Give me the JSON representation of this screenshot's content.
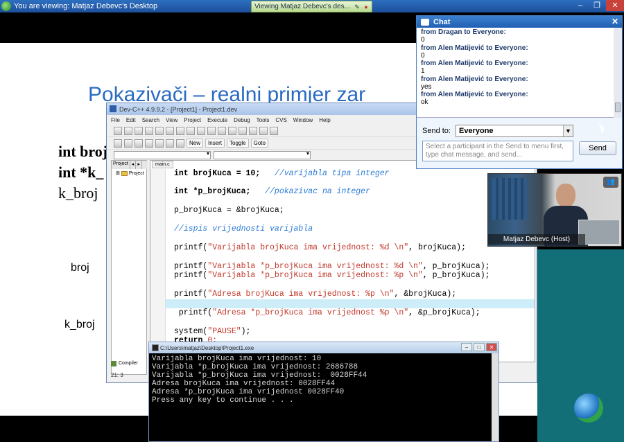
{
  "viewer_bar": {
    "title": "You are viewing: Matjaz Debevc's Desktop",
    "tab_label": "Viewing Matjaz Debevc's des..."
  },
  "slide": {
    "title": "Pokazivači – realni primjer zar",
    "line1": "int broj",
    "line2": "int *k_",
    "line3": "k_broj",
    "label_broj": "broj",
    "label_kbroj": "k_broj"
  },
  "devcpp": {
    "title": "Dev-C++ 4.9.9.2 - [Project1] - Project1.dev",
    "menu": [
      "File",
      "Edit",
      "Search",
      "View",
      "Project",
      "Execute",
      "Debug",
      "Tools",
      "CVS",
      "Window",
      "Help"
    ],
    "toolbar": {
      "new": "New",
      "insert": "Insert",
      "toggle": "Toggle",
      "goto": "Goto"
    },
    "project_tab": "Project",
    "project_item": "Project",
    "editor_tab": "main.c",
    "bottom_tab": "Compiler",
    "status": "21: 3"
  },
  "code": {
    "l1a": "int brojKuca = 10;   ",
    "l1b": "//varijabla tipa integer",
    "l2a": "int *p_brojKuca;   ",
    "l2b": "//pokazivac na integer",
    "l3": "p_brojKuca = &brojKuca;",
    "l4": "//ispis vrijednosti varijabla",
    "l5a": "printf(",
    "l5b": "\"Varijabla brojKuca ima vrijednost: %d \\n\"",
    "l5c": ", brojKuca);",
    "l6a": "printf(",
    "l6b": "\"Varijabla *p_brojKuca ima vrijednost: %d \\n\"",
    "l6c": ", p_brojKuca);",
    "l7a": "printf(",
    "l7b": "\"Varijabla *p_brojKuca ima vrijednost: %p \\n\"",
    "l7c": ", p_brojKuca);",
    "l8a": "printf(",
    "l8b": "\"Adresa brojKuca ima vrijednost: %p \\n\"",
    "l8c": ", &brojKuca);",
    "l9a": " printf(",
    "l9b": "\"Adresa *p_brojKuca ima vrijednost %p \\n\"",
    "l9c": ", &p_brojKuca);",
    "l10a": "system(",
    "l10b": "\"PAUSE\"",
    "l10c": ");",
    "l11a": "return ",
    "l11b": "0;"
  },
  "console": {
    "title": "C:\\Users\\matjaz\\Desktop\\Project1.exe",
    "output": "Varijabla brojKuca ima vrijednost: 10\nVarijabla *p_brojKuca ima vrijednost: 2686788\nVarijabla *p_brojKuca ima vrijednost:  0028FF44\nAdresa brojKuca ima vrijednost: 0028FF44\nAdresa *p_brojKuca ima vrijednost 0028FF40\nPress any key to continue . . ."
  },
  "chat": {
    "title": "Chat",
    "messages": [
      {
        "from": "from Dragan to Everyone:",
        "body": "0"
      },
      {
        "from": "from Alen Matijević to Everyone:",
        "body": "0"
      },
      {
        "from": "from Alen Matijević to Everyone:",
        "body": "1"
      },
      {
        "from": "from Alen Matijević to Everyone:",
        "body": "yes"
      },
      {
        "from": "from Alen Matijević to Everyone:",
        "body": "ok"
      }
    ],
    "send_to_label": "Send to:",
    "send_to_value": "Everyone",
    "input_placeholder": "Select a participant in the Send to menu first, type chat message, and send...",
    "send_button": "Send"
  },
  "video": {
    "name": "Matjaz Debevc (Host)"
  }
}
